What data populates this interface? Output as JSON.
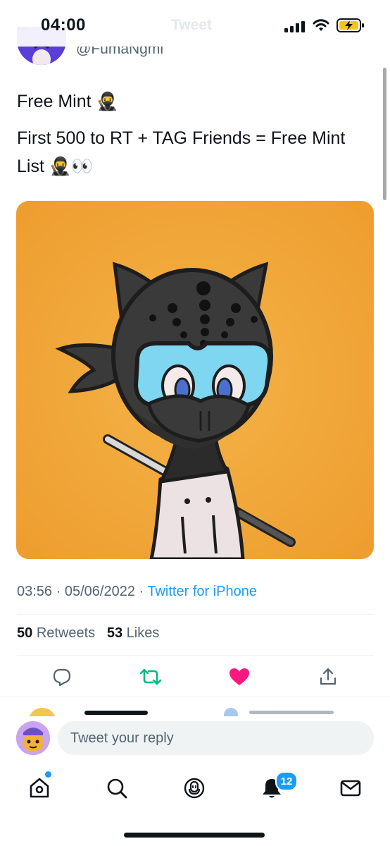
{
  "status_bar": {
    "time": "04:00"
  },
  "header": {
    "title": "Tweet"
  },
  "author": {
    "handle": "@FumaNgmi"
  },
  "tweet": {
    "line1": "Free Mint 🥷",
    "line2": "First 500 to RT + TAG Friends = Free Mint List 🥷👀"
  },
  "meta": {
    "time": "03:56",
    "date": "05/06/2022",
    "source": "Twitter for iPhone"
  },
  "counts": {
    "retweets": "50",
    "retweets_label": "Retweets",
    "likes": "53",
    "likes_label": "Likes"
  },
  "actions": [
    "reply-icon",
    "retweet-icon",
    "like-icon",
    "share-icon"
  ],
  "composer": {
    "placeholder": "Tweet your reply"
  },
  "tabbar": {
    "notifications_badge": "12",
    "items": [
      "home-icon",
      "search-icon",
      "spaces-icon",
      "notifications-icon",
      "messages-icon"
    ]
  },
  "colors": {
    "accent": "#1d9bf0",
    "retweet_green": "#00ba7c",
    "like_pink": "#f91880",
    "media_background": "#f2a93b"
  }
}
